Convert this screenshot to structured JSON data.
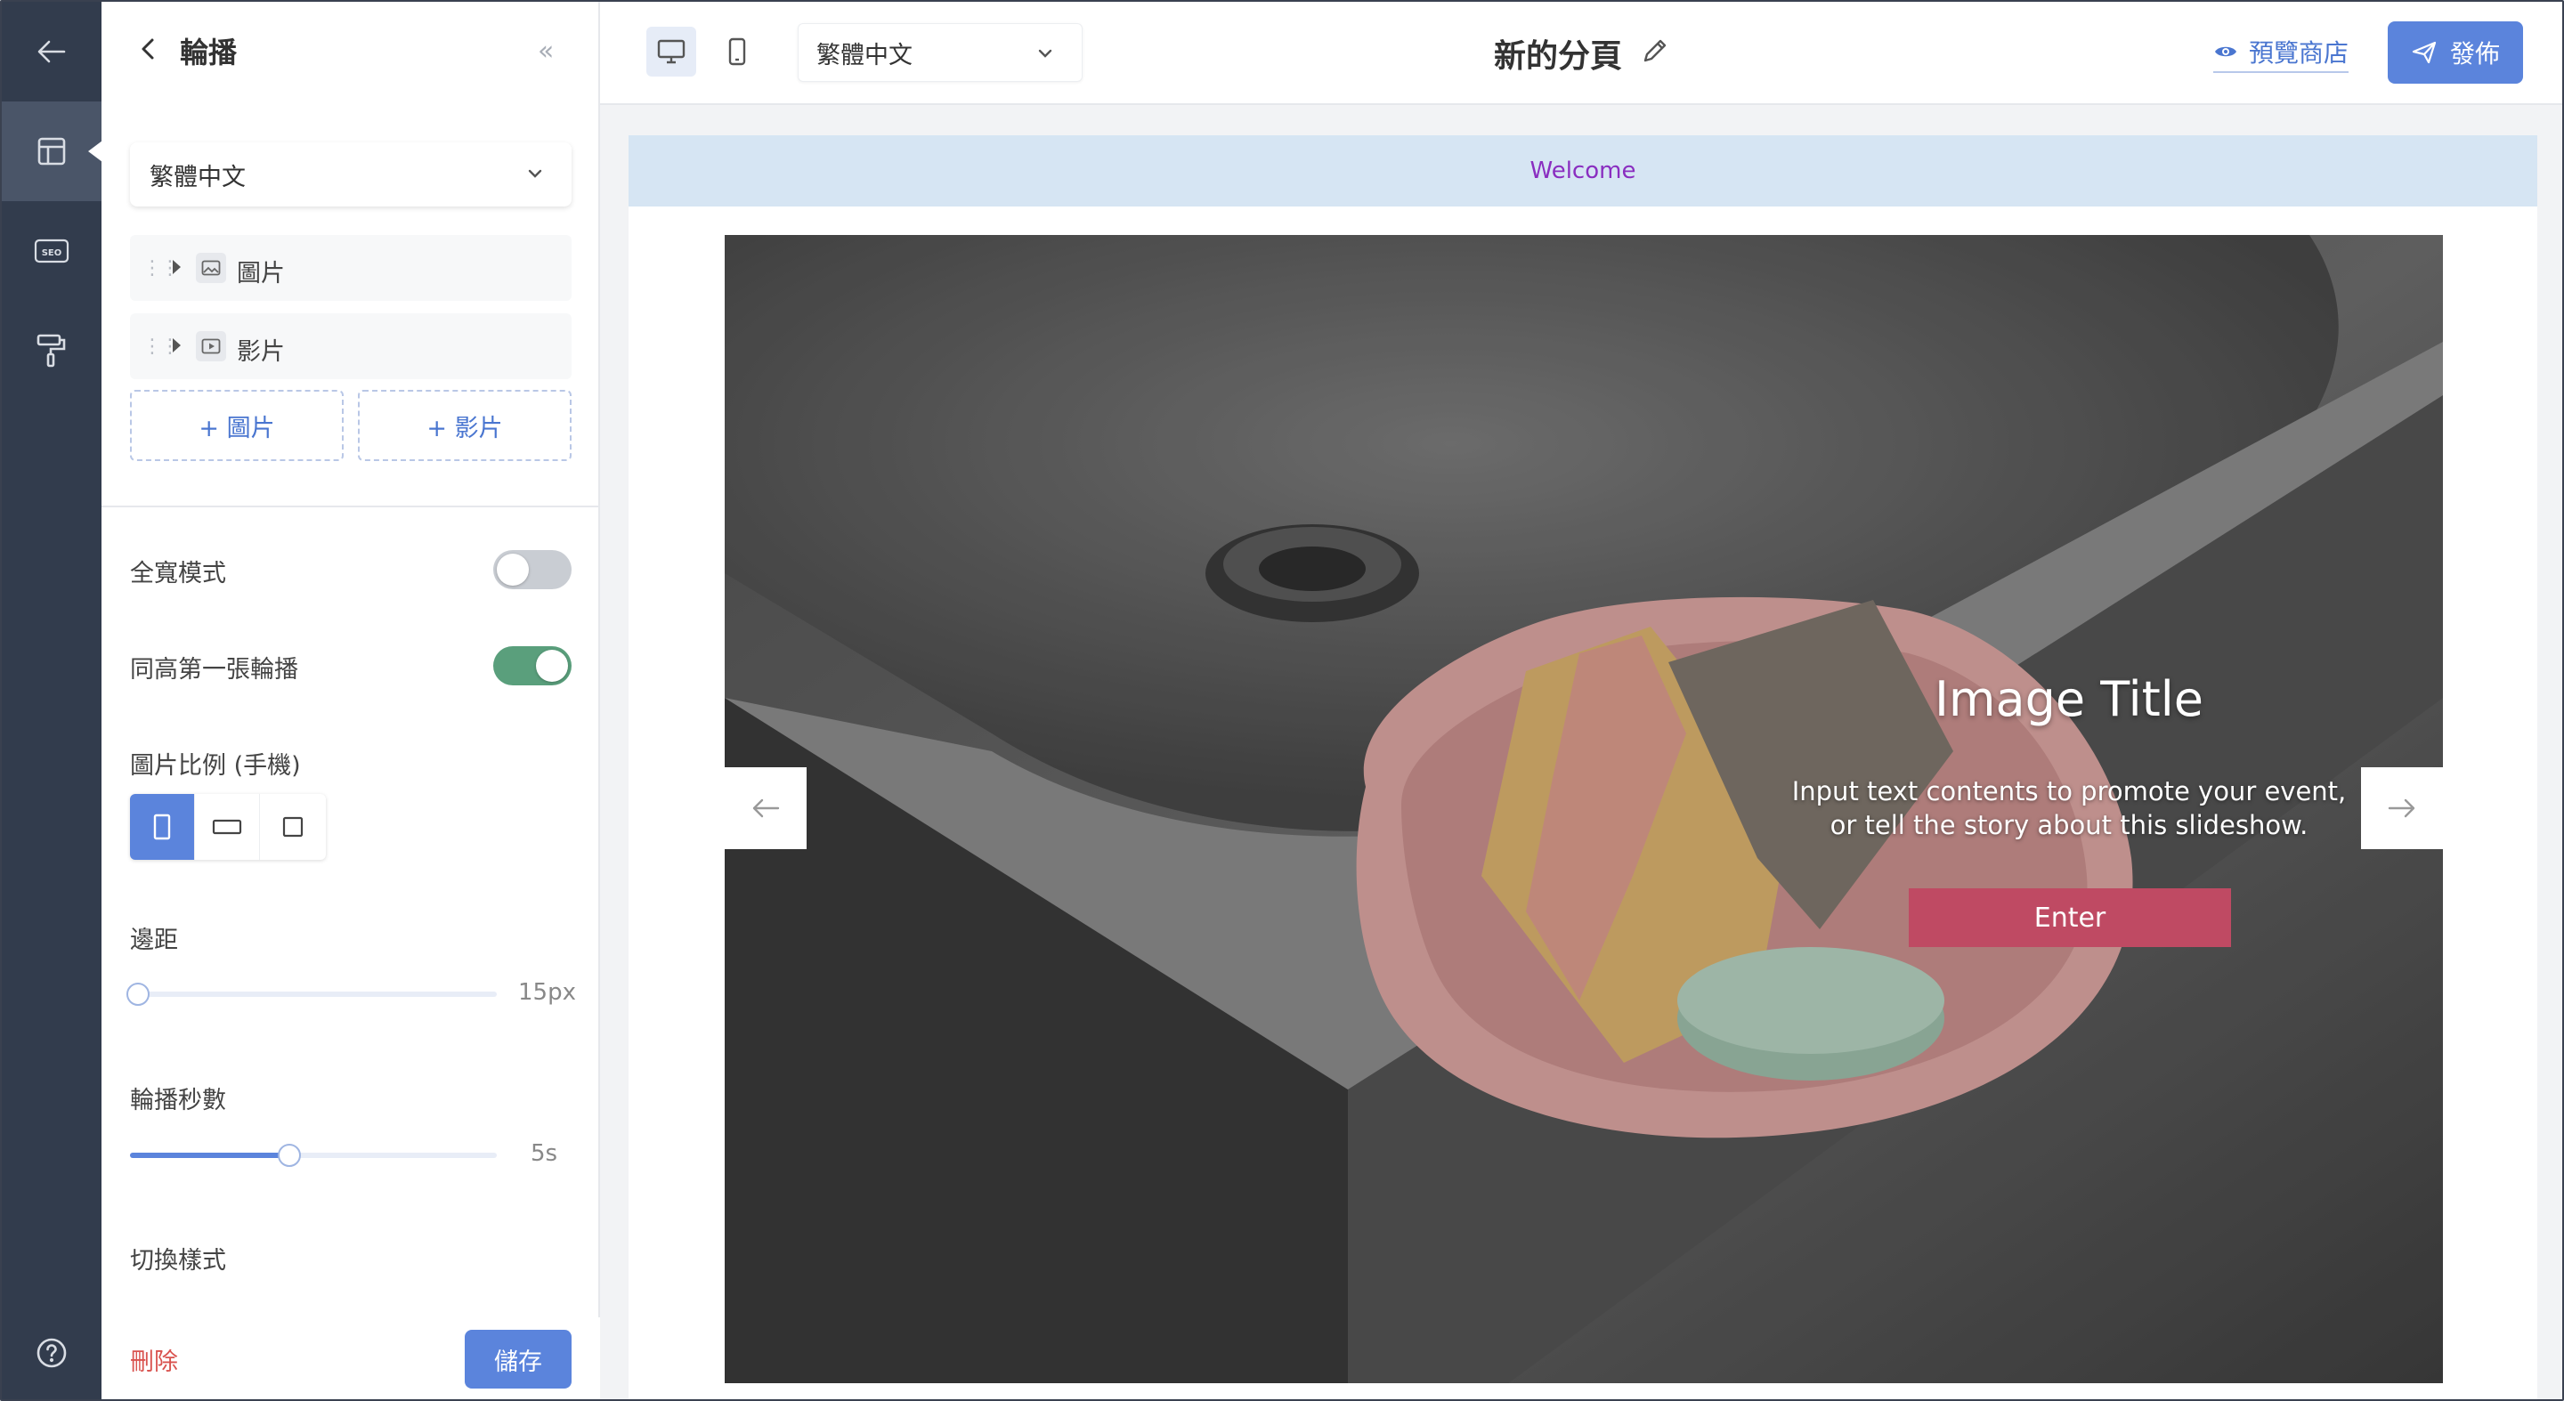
{
  "panel": {
    "title": "輪播",
    "language": "繁體中文",
    "items": [
      {
        "label": "圖片"
      },
      {
        "label": "影片"
      }
    ],
    "add_image_label": "+ 圖片",
    "add_video_label": "+ 影片",
    "full_width_label": "全寬模式",
    "full_width_on": false,
    "same_height_label": "同高第一張輪播",
    "same_height_on": true,
    "ratio_label": "圖片比例 (手機)",
    "ratio_selected": "portrait",
    "margin_label": "邊距",
    "margin_value_text": "15px",
    "margin_value_fraction": 0.0,
    "duration_label": "輪播秒數",
    "duration_value_text": "5s",
    "duration_value_fraction": 0.44,
    "transition_label": "切換樣式",
    "transition_peek": "...",
    "delete_label": "刪除",
    "save_label": "儲存"
  },
  "topbar": {
    "language": "繁體中文",
    "page_name": "新的分頁",
    "preview_label": "預覽商店",
    "publish_label": "發佈"
  },
  "canvas": {
    "welcome_text": "Welcome",
    "slide": {
      "title": "Image Title",
      "description": "Input text contents to promote your event, or tell the story about this slideshow.",
      "cta_label": "Enter"
    }
  },
  "colors": {
    "rail": "#323c4d",
    "accent": "#5b84dc",
    "toggle_on": "#5a9f7c",
    "welcome_bg": "#d6e5f3",
    "welcome_text": "#8a2ec0",
    "cta": "#bf4a63",
    "danger": "#d9534f"
  },
  "icons": {
    "rail": [
      "back-arrow-icon",
      "layout-icon",
      "seo-icon",
      "paint-roller-icon",
      "help-icon"
    ],
    "topbar": [
      "desktop-icon",
      "mobile-icon",
      "chevron-down-icon",
      "pencil-icon",
      "eye-icon",
      "send-icon"
    ]
  }
}
